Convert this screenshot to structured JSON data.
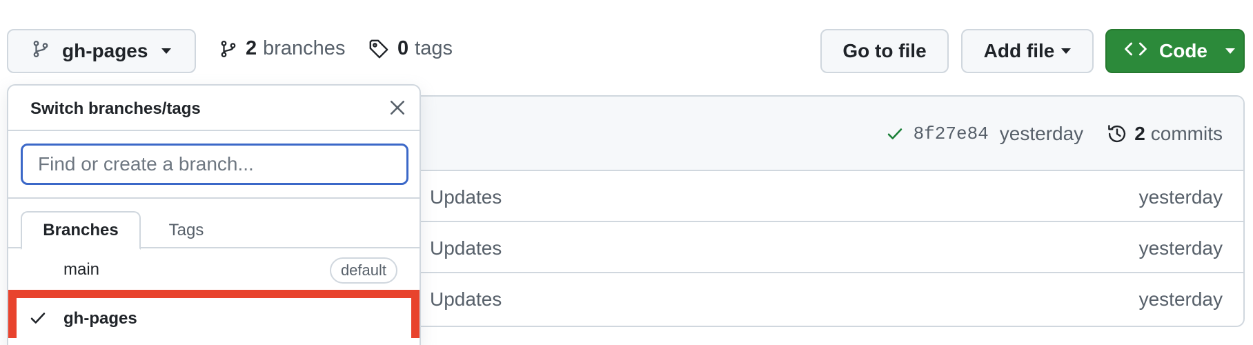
{
  "branch_selector": {
    "current": "gh-pages"
  },
  "meta": {
    "branches_count": "2",
    "branches_label": "branches",
    "tags_count": "0",
    "tags_label": "tags"
  },
  "actions": {
    "goto_file": "Go to file",
    "add_file": "Add file",
    "code": "Code"
  },
  "commit_bar": {
    "sha": "8f27e84",
    "time": "yesterday",
    "commits_count": "2",
    "commits_label": "commits"
  },
  "files": [
    {
      "message": "Updates",
      "age": "yesterday"
    },
    {
      "message": "Updates",
      "age": "yesterday"
    },
    {
      "message": "Updates",
      "age": "yesterday"
    }
  ],
  "dropdown": {
    "title": "Switch branches/tags",
    "search_placeholder": "Find or create a branch...",
    "tabs": [
      "Branches",
      "Tags"
    ],
    "branches": [
      {
        "name": "main",
        "badge": "default"
      },
      {
        "name": "gh-pages",
        "selected": true
      }
    ]
  },
  "colors": {
    "accent_blue": "#3b68c8",
    "code_green": "#2c8a3a",
    "highlight_red": "#e8432d",
    "success_check": "#1a7f37"
  }
}
